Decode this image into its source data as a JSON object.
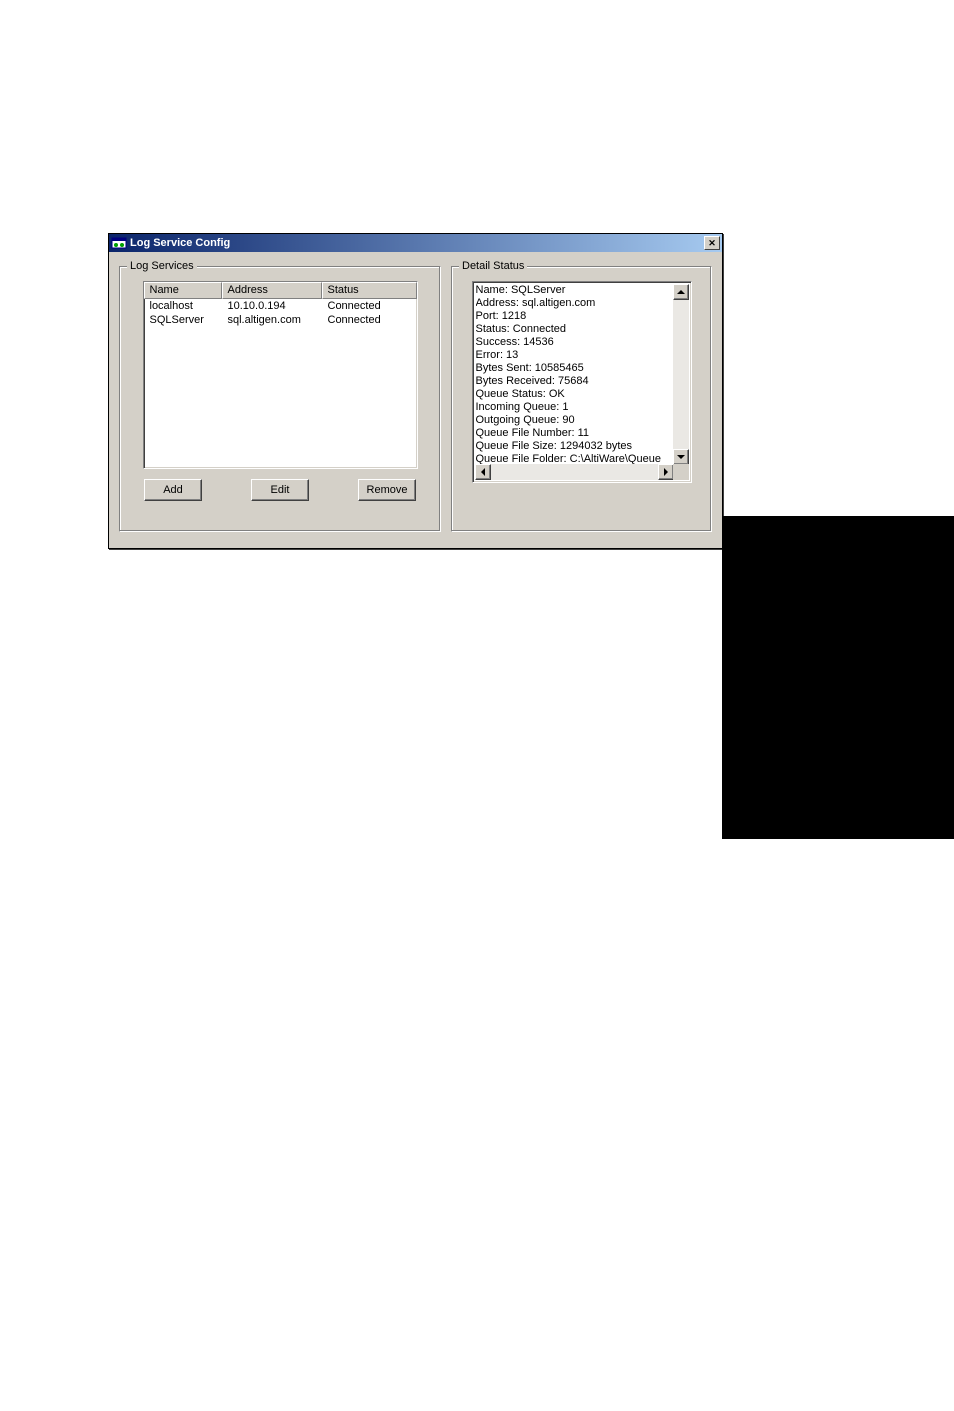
{
  "window": {
    "title": "Log Service Config"
  },
  "log_services": {
    "groupbox_label": "Log Services",
    "columns": {
      "name": "Name",
      "address": "Address",
      "status": "Status"
    },
    "rows": [
      {
        "name": "localhost",
        "address": "10.10.0.194",
        "status": "Connected"
      },
      {
        "name": "SQLServer",
        "address": "sql.altigen.com",
        "status": "Connected"
      }
    ],
    "buttons": {
      "add": "Add",
      "edit": "Edit",
      "remove": "Remove"
    }
  },
  "detail_status": {
    "groupbox_label": "Detail Status",
    "lines": [
      "Name: SQLServer",
      "Address: sql.altigen.com",
      "Port: 1218",
      "Status: Connected",
      "Success: 14536",
      "Error: 13",
      "Bytes Sent: 10585465",
      "Bytes Received: 75684",
      "Queue Status: OK",
      "Incoming Queue: 1",
      "Outgoing Queue: 90",
      "Queue File Number: 11",
      "Queue File Size: 1294032 bytes",
      "Queue File Folder: C:\\AltiWare\\Queue"
    ]
  }
}
